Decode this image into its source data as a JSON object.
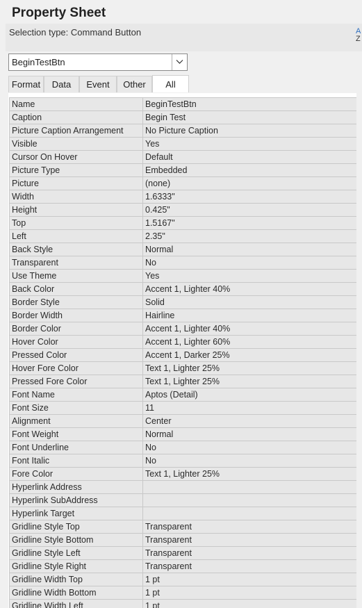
{
  "panel": {
    "title": "Property Sheet",
    "selection_type_label": "Selection type:  Command Button",
    "sort_icon_top": "A",
    "sort_icon_bottom": "Z"
  },
  "object_selector": {
    "value": "BeginTestBtn"
  },
  "tabs": [
    {
      "label": "Format",
      "active": false
    },
    {
      "label": "Data",
      "active": false
    },
    {
      "label": "Event",
      "active": false
    },
    {
      "label": "Other",
      "active": false
    },
    {
      "label": "All",
      "active": true
    }
  ],
  "properties": [
    {
      "name": "Name",
      "value": "BeginTestBtn"
    },
    {
      "name": "Caption",
      "value": "Begin Test"
    },
    {
      "name": "Picture Caption Arrangement",
      "value": "No Picture Caption"
    },
    {
      "name": "Visible",
      "value": "Yes"
    },
    {
      "name": "Cursor On Hover",
      "value": "Default"
    },
    {
      "name": "Picture Type",
      "value": "Embedded"
    },
    {
      "name": "Picture",
      "value": "(none)"
    },
    {
      "name": "Width",
      "value": "1.6333\""
    },
    {
      "name": "Height",
      "value": "0.425\""
    },
    {
      "name": "Top",
      "value": "1.5167\""
    },
    {
      "name": "Left",
      "value": "2.35\""
    },
    {
      "name": "Back Style",
      "value": "Normal"
    },
    {
      "name": "Transparent",
      "value": "No"
    },
    {
      "name": "Use Theme",
      "value": "Yes"
    },
    {
      "name": "Back Color",
      "value": "Accent 1, Lighter 40%"
    },
    {
      "name": "Border Style",
      "value": "Solid"
    },
    {
      "name": "Border Width",
      "value": "Hairline"
    },
    {
      "name": "Border Color",
      "value": "Accent 1, Lighter 40%"
    },
    {
      "name": "Hover Color",
      "value": "Accent 1, Lighter 60%"
    },
    {
      "name": "Pressed Color",
      "value": "Accent 1, Darker 25%"
    },
    {
      "name": "Hover Fore Color",
      "value": "Text 1, Lighter 25%"
    },
    {
      "name": "Pressed Fore Color",
      "value": "Text 1, Lighter 25%"
    },
    {
      "name": "Font Name",
      "value": "Aptos (Detail)"
    },
    {
      "name": "Font Size",
      "value": "11"
    },
    {
      "name": "Alignment",
      "value": "Center"
    },
    {
      "name": "Font Weight",
      "value": "Normal"
    },
    {
      "name": "Font Underline",
      "value": "No"
    },
    {
      "name": "Font Italic",
      "value": "No"
    },
    {
      "name": "Fore Color",
      "value": "Text 1, Lighter 25%"
    },
    {
      "name": "Hyperlink Address",
      "value": ""
    },
    {
      "name": "Hyperlink SubAddress",
      "value": ""
    },
    {
      "name": "Hyperlink Target",
      "value": ""
    },
    {
      "name": "Gridline Style Top",
      "value": "Transparent"
    },
    {
      "name": "Gridline Style Bottom",
      "value": "Transparent"
    },
    {
      "name": "Gridline Style Left",
      "value": "Transparent"
    },
    {
      "name": "Gridline Style Right",
      "value": "Transparent"
    },
    {
      "name": "Gridline Width Top",
      "value": "1 pt"
    },
    {
      "name": "Gridline Width Bottom",
      "value": "1 pt"
    },
    {
      "name": "Gridline Width Left",
      "value": "1 pt"
    }
  ]
}
